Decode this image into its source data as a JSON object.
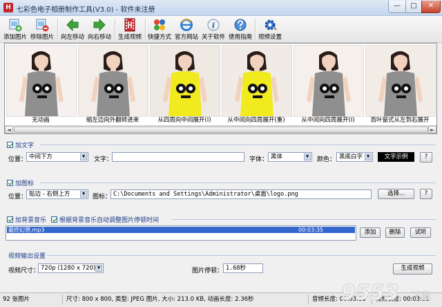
{
  "window": {
    "title": "七彩色电子相册制作工具(V3.0) - 软件未注册",
    "app_icon": "H",
    "buttons": {
      "minimize": "—",
      "maximize": "□",
      "close": "✕"
    }
  },
  "toolbar": {
    "items": [
      {
        "label": "添加图片",
        "icon": "add-image-icon"
      },
      {
        "label": "移除图片",
        "icon": "remove-image-icon"
      },
      {
        "label": "向左移动",
        "icon": "arrow-left-icon"
      },
      {
        "label": "向右移动",
        "icon": "arrow-right-icon"
      },
      {
        "label": "生成视频",
        "icon": "film-icon"
      },
      {
        "label": "快捷方式",
        "icon": "shortcut-icon"
      },
      {
        "label": "官方网站",
        "icon": "ie-icon"
      },
      {
        "label": "关于软件",
        "icon": "info-icon"
      },
      {
        "label": "使用指南",
        "icon": "guide-icon"
      },
      {
        "label": "视频设置",
        "icon": "gear-icon"
      }
    ],
    "colors": {
      "green": "#3da33a",
      "red": "#c9282d",
      "blue": "#2f6fc4"
    }
  },
  "thumbnails": [
    {
      "caption": "无动画",
      "dress": "#8f8f8f"
    },
    {
      "caption": "缩左边向外翻转进来",
      "dress": "#8f8f8f"
    },
    {
      "caption": "从四周向中间展开(I)",
      "dress": "#f0ea1f"
    },
    {
      "caption": "从中间向四周展开(重)",
      "dress": "#f0ea1f"
    },
    {
      "caption": "从中间向四周展开(I)",
      "dress": "#8f8f8f"
    },
    {
      "caption": "百叶窗式从左到右展开",
      "dress": "#8f8f8f"
    }
  ],
  "text_section": {
    "checkbox_label": "加文字",
    "checked": true,
    "position_label": "位置：",
    "position_value": "中间下方",
    "text_label": "文字：",
    "text_value": "",
    "font_label": "字体：",
    "font_value": "黑体",
    "color_label": "颜色：",
    "color_value": "黑底白字",
    "sample_label": "文字示例",
    "help_label": "?"
  },
  "icon_section": {
    "checkbox_label": "加图标",
    "checked": true,
    "position_label": "位置：",
    "position_value": "贴边  - 右侧上方",
    "icon_label": "图标：",
    "icon_path": "C:\\Documents and Settings\\Administrator\\桌面\\logo.png",
    "select_label": "选择...",
    "help_label": "?"
  },
  "music_section": {
    "checkbox_label": "加背景音乐",
    "checked": true,
    "auto_adjust_label": "根据背景音乐自动调整图片停顿时间",
    "auto_adjust_checked": true,
    "track_name": "最终幻想.mp3",
    "track_duration": "00:03:35",
    "add_label": "添加",
    "delete_label": "删除",
    "preview_label": "试听"
  },
  "video_output": {
    "section_label": "视频输出设置",
    "size_label": "视频尺寸：",
    "size_value": "720p (1280 x  720)",
    "pause_label": "图片停顿：",
    "pause_value": "1.68秒",
    "generate_label": "生成视频"
  },
  "statusbar": {
    "count": "92 张图片",
    "info": "尺寸: 800 x 800, 类型: JPEG 图片, 大小: 213.0 KB, 动画长度: 2.36秒",
    "audio_label": "音频长度:",
    "audio_value": "00:03:35",
    "video_label": "视频长度:",
    "video_value": "00:03:35"
  },
  "watermark": {
    "text": "9553",
    "sub": "下载"
  }
}
